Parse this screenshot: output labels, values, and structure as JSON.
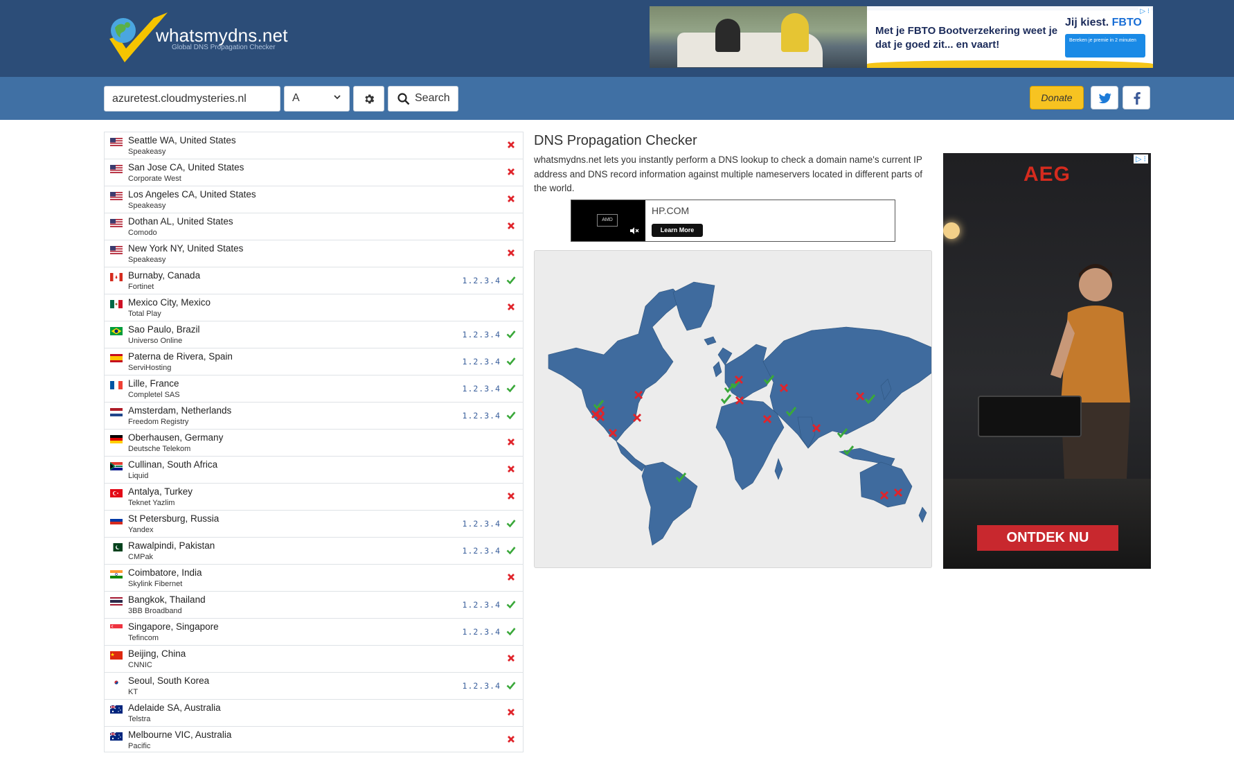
{
  "header": {
    "logo_text": "whatsmydns.net",
    "logo_tagline": "Global DNS Propagation Checker"
  },
  "top_ad": {
    "text": "Met je FBTO Bootverzekering weet je dat je goed zit... en vaart!",
    "brand_prefix": "Jij kiest.",
    "brand": "FBTO",
    "button": "Bereken je premie in 2 minuten",
    "adchoice": "▷ ⁝"
  },
  "search": {
    "domain_value": "azuretest.cloudmysteries.nl",
    "record_type": "A",
    "search_label": "Search",
    "donate_label": "Donate"
  },
  "results": [
    {
      "location": "Seattle WA, United States",
      "provider": "Speakeasy",
      "ip": "",
      "ok": false,
      "flag": "us"
    },
    {
      "location": "San Jose CA, United States",
      "provider": "Corporate West",
      "ip": "",
      "ok": false,
      "flag": "us"
    },
    {
      "location": "Los Angeles CA, United States",
      "provider": "Speakeasy",
      "ip": "",
      "ok": false,
      "flag": "us"
    },
    {
      "location": "Dothan AL, United States",
      "provider": "Comodo",
      "ip": "",
      "ok": false,
      "flag": "us"
    },
    {
      "location": "New York NY, United States",
      "provider": "Speakeasy",
      "ip": "",
      "ok": false,
      "flag": "us"
    },
    {
      "location": "Burnaby, Canada",
      "provider": "Fortinet",
      "ip": "1.2.3.4",
      "ok": true,
      "flag": "ca"
    },
    {
      "location": "Mexico City, Mexico",
      "provider": "Total Play",
      "ip": "",
      "ok": false,
      "flag": "mx"
    },
    {
      "location": "Sao Paulo, Brazil",
      "provider": "Universo Online",
      "ip": "1.2.3.4",
      "ok": true,
      "flag": "br"
    },
    {
      "location": "Paterna de Rivera, Spain",
      "provider": "ServiHosting",
      "ip": "1.2.3.4",
      "ok": true,
      "flag": "es"
    },
    {
      "location": "Lille, France",
      "provider": "Completel SAS",
      "ip": "1.2.3.4",
      "ok": true,
      "flag": "fr"
    },
    {
      "location": "Amsterdam, Netherlands",
      "provider": "Freedom Registry",
      "ip": "1.2.3.4",
      "ok": true,
      "flag": "nl"
    },
    {
      "location": "Oberhausen, Germany",
      "provider": "Deutsche Telekom",
      "ip": "",
      "ok": false,
      "flag": "de"
    },
    {
      "location": "Cullinan, South Africa",
      "provider": "Liquid",
      "ip": "",
      "ok": false,
      "flag": "za"
    },
    {
      "location": "Antalya, Turkey",
      "provider": "Teknet Yazlim",
      "ip": "",
      "ok": false,
      "flag": "tr"
    },
    {
      "location": "St Petersburg, Russia",
      "provider": "Yandex",
      "ip": "1.2.3.4",
      "ok": true,
      "flag": "ru"
    },
    {
      "location": "Rawalpindi, Pakistan",
      "provider": "CMPak",
      "ip": "1.2.3.4",
      "ok": true,
      "flag": "pk"
    },
    {
      "location": "Coimbatore, India",
      "provider": "Skylink Fibernet",
      "ip": "",
      "ok": false,
      "flag": "in"
    },
    {
      "location": "Bangkok, Thailand",
      "provider": "3BB Broadband",
      "ip": "1.2.3.4",
      "ok": true,
      "flag": "th"
    },
    {
      "location": "Singapore, Singapore",
      "provider": "Tefincom",
      "ip": "1.2.3.4",
      "ok": true,
      "flag": "sg"
    },
    {
      "location": "Beijing, China",
      "provider": "CNNIC",
      "ip": "",
      "ok": false,
      "flag": "cn"
    },
    {
      "location": "Seoul, South Korea",
      "provider": "KT",
      "ip": "1.2.3.4",
      "ok": true,
      "flag": "kr"
    },
    {
      "location": "Adelaide SA, Australia",
      "provider": "Telstra",
      "ip": "",
      "ok": false,
      "flag": "au"
    },
    {
      "location": "Melbourne VIC, Australia",
      "provider": "Pacific",
      "ip": "",
      "ok": false,
      "flag": "au"
    }
  ],
  "main": {
    "title": "DNS Propagation Checker",
    "description": "whatsmydns.net lets you instantly perform a DNS lookup to check a domain name's current IP address and DNS record information against multiple nameservers located in different parts of the world."
  },
  "inline_ad": {
    "brand": "HP.COM",
    "button": "Learn More",
    "video_logo": "AMD"
  },
  "side_ad": {
    "brand": "AEG",
    "cta": "ONTDEK NU",
    "adchoice": "▷ ⁝"
  },
  "colors": {
    "header": "#2c4d78",
    "searchbar": "#4070a4",
    "ok": "#3aa83a",
    "fail": "#e0242b",
    "map_land": "#3f6b9e",
    "donate": "#f7c321"
  }
}
